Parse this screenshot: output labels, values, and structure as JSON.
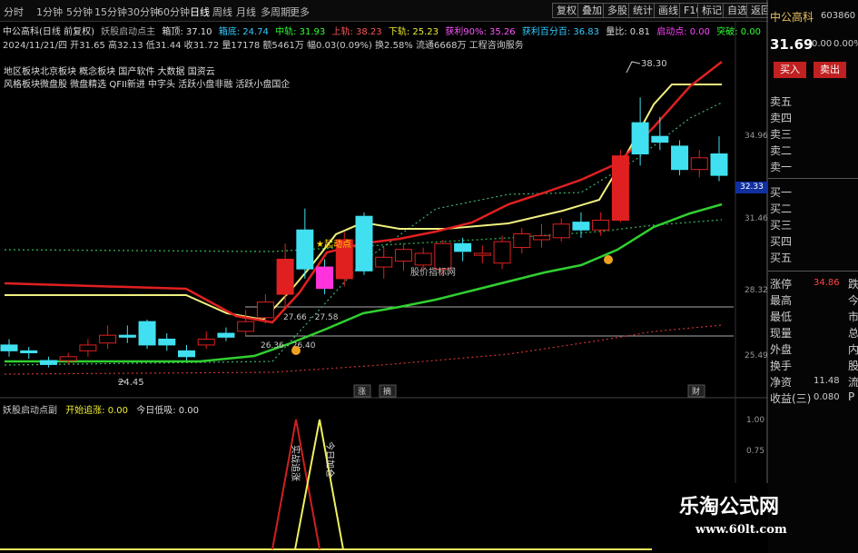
{
  "toolbar": {
    "periods": [
      "分时",
      "1分钟",
      "5分钟",
      "15分钟",
      "30分钟",
      "60分钟",
      "日线",
      "周线",
      "月线",
      "多周期",
      "更多"
    ],
    "active_period": "日线",
    "buttons": [
      "复权",
      "叠加",
      "多股",
      "统计",
      "画线",
      "F10",
      "标记",
      "自选",
      "返回"
    ]
  },
  "info": {
    "stock_title": "中公高科(日线 前复权)",
    "indicator_title": "妖股启动点主",
    "box_top": "箱顶: 37.10",
    "box_bottom": "箱底: 24.74",
    "mid_rail": "中轨: 31.93",
    "upper_rail": "上轨: 38.23",
    "lower_rail": "下轨: 25.23",
    "profit90": "获利90%: 35.26",
    "profit_pct": "获利百分百: 36.83",
    "vol_ratio": "量比: 0.81",
    "start_point": "启动点: 0.00",
    "breakout": "突破: 0.00",
    "line2": "2024/11/21/四 开31.65 高32.13 低31.44 收31.72 量17178 额5461万 幅0.03(0.09%) 换2.58% 流通6668万 工程咨询服务",
    "concept1": "地区板块北京板块 概念板块 国产软件 大数据 国资云",
    "concept2": "风格板块微盘股 微盘精选 QFII新进 中字头 活跃小盘非融 活跃小盘国企"
  },
  "annotations": {
    "high_price": "38.30",
    "low_price": "24.45",
    "band_label": "27.66 - 27.58",
    "band_label2": "26.36 - 26.40",
    "startup_label": "起动点",
    "vol_label": "股价指标网",
    "bottom_tag1": "涨",
    "bottom_tag2": "摘",
    "bottom_tag3": "财"
  },
  "price_axis": [
    "34.96",
    "31.46",
    "28.32",
    "25.49"
  ],
  "current_price_tag": "32.33",
  "sub": {
    "title": "妖股启动点副",
    "signal1_label": "开始追涨: 0.00",
    "signal2_label": "今日低吸: 0.00",
    "axis": [
      "1.00",
      "0.75"
    ],
    "peak_label1": "实战追涨",
    "peak_label2": "今日加仓"
  },
  "right_panel": {
    "name": "中公高科",
    "code": "603860",
    "price": "31.69",
    "change": "0.00",
    "change_pct": "0.00%",
    "buy_btn": "买入",
    "sell_btn": "卖出",
    "sell_levels": [
      "卖五",
      "卖四",
      "卖三",
      "卖二",
      "卖一"
    ],
    "buy_levels": [
      "买一",
      "买二",
      "买三",
      "买四",
      "买五"
    ],
    "stats": [
      {
        "label": "涨停",
        "value": "34.86",
        "value_color": "#ff4444",
        "extra": "跌"
      },
      {
        "label": "最高",
        "value": "",
        "value_color": "#ff4444",
        "extra": "今"
      },
      {
        "label": "最低",
        "value": "",
        "value_color": "#ff4444",
        "extra": "市"
      },
      {
        "label": "现量",
        "value": "",
        "value_color": "#ccc",
        "extra": "总"
      },
      {
        "label": "外盘",
        "value": "",
        "value_color": "#ccc",
        "extra": "内"
      },
      {
        "label": "换手",
        "value": "",
        "value_color": "#ccc",
        "extra": "股"
      },
      {
        "label": "净资",
        "value": "11.48",
        "value_color": "#ccc",
        "extra": "流"
      },
      {
        "label": "收益(三)",
        "value": "0.080",
        "value_color": "#ccc",
        "extra": "P"
      }
    ]
  },
  "watermark": {
    "title": "乐淘公式网",
    "url": "www.60lt.com"
  },
  "chart_data": {
    "type": "candlestick",
    "ylim": [
      23.5,
      40.5
    ],
    "candles": [
      {
        "o": 25.6,
        "c": 25.3,
        "h": 25.9,
        "l": 25.0
      },
      {
        "o": 25.3,
        "c": 25.2,
        "h": 25.5,
        "l": 24.9
      },
      {
        "o": 24.8,
        "c": 24.6,
        "h": 25.0,
        "l": 24.45
      },
      {
        "o": 24.8,
        "c": 25.0,
        "h": 25.2,
        "l": 24.6
      },
      {
        "o": 25.3,
        "c": 25.6,
        "h": 25.9,
        "l": 25.0
      },
      {
        "o": 25.7,
        "c": 26.1,
        "h": 26.6,
        "l": 25.4
      },
      {
        "o": 26.1,
        "c": 26.0,
        "h": 26.6,
        "l": 25.7
      },
      {
        "o": 26.8,
        "c": 25.6,
        "h": 26.9,
        "l": 25.4
      },
      {
        "o": 25.9,
        "c": 25.6,
        "h": 26.2,
        "l": 25.3
      },
      {
        "o": 25.3,
        "c": 25.0,
        "h": 25.6,
        "l": 24.8
      },
      {
        "o": 25.6,
        "c": 25.9,
        "h": 26.3,
        "l": 25.4
      },
      {
        "o": 26.2,
        "c": 26.0,
        "h": 26.5,
        "l": 25.8
      },
      {
        "o": 26.3,
        "c": 26.8,
        "h": 27.4,
        "l": 26.1
      },
      {
        "o": 27.0,
        "c": 27.8,
        "h": 28.2,
        "l": 26.7
      },
      {
        "o": 28.2,
        "c": 30.0,
        "h": 30.8,
        "l": 27.6
      },
      {
        "o": 31.5,
        "c": 29.5,
        "h": 32.6,
        "l": 29.0
      },
      {
        "o": 29.6,
        "c": 28.5,
        "h": 30.0,
        "l": 28.2
      },
      {
        "o": 29.0,
        "c": 31.0,
        "h": 31.4,
        "l": 28.6
      },
      {
        "o": 32.2,
        "c": 29.4,
        "h": 32.4,
        "l": 29.2
      },
      {
        "o": 29.6,
        "c": 30.1,
        "h": 30.6,
        "l": 29.0
      },
      {
        "o": 29.9,
        "c": 30.5,
        "h": 30.8,
        "l": 29.4
      },
      {
        "o": 29.7,
        "c": 30.3,
        "h": 30.6,
        "l": 29.4
      },
      {
        "o": 29.5,
        "c": 30.8,
        "h": 31.0,
        "l": 29.2
      },
      {
        "o": 30.8,
        "c": 30.4,
        "h": 31.1,
        "l": 29.9
      },
      {
        "o": 30.2,
        "c": 30.3,
        "h": 30.7,
        "l": 29.8
      },
      {
        "o": 29.8,
        "c": 30.9,
        "h": 31.2,
        "l": 29.5
      },
      {
        "o": 30.6,
        "c": 31.3,
        "h": 31.6,
        "l": 30.3
      },
      {
        "o": 31.0,
        "c": 31.2,
        "h": 31.8,
        "l": 30.6
      },
      {
        "o": 31.1,
        "c": 31.8,
        "h": 32.1,
        "l": 30.9
      },
      {
        "o": 31.9,
        "c": 31.5,
        "h": 32.4,
        "l": 31.1
      },
      {
        "o": 31.5,
        "c": 32.0,
        "h": 32.4,
        "l": 31.2
      },
      {
        "o": 32.0,
        "c": 35.3,
        "h": 35.6,
        "l": 31.9
      },
      {
        "o": 37.0,
        "c": 35.4,
        "h": 38.3,
        "l": 34.8
      },
      {
        "o": 36.3,
        "c": 36.0,
        "h": 37.3,
        "l": 35.6
      },
      {
        "o": 35.8,
        "c": 34.6,
        "h": 36.1,
        "l": 34.3
      },
      {
        "o": 34.6,
        "c": 35.2,
        "h": 35.6,
        "l": 34.2
      },
      {
        "o": 35.4,
        "c": 34.3,
        "h": 36.3,
        "l": 34.0
      }
    ]
  }
}
